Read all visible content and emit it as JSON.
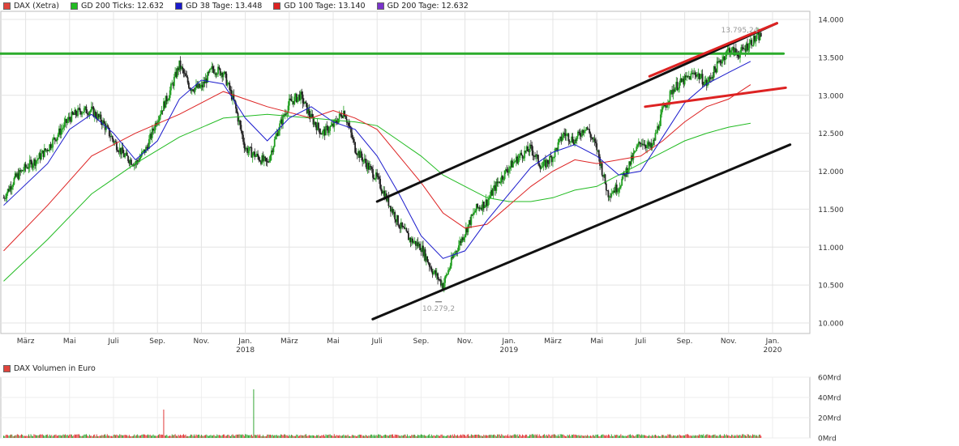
{
  "legend": [
    {
      "label": "DAX (Xetra)",
      "color": "#e0443c"
    },
    {
      "label": "GD 200 Ticks: 12.632",
      "color": "#22bb22"
    },
    {
      "label": "GD 38 Tage: 13.448",
      "color": "#1a1acc"
    },
    {
      "label": "GD 100 Tage: 13.140",
      "color": "#dd2222"
    },
    {
      "label": "GD 200 Tage: 12.632",
      "color": "#7a33cc"
    }
  ],
  "volume_label": "DAX Volumen in Euro",
  "volume_color": "#e0443c",
  "annotations": {
    "high_label": "13.795,24",
    "low_label": "10.279,2"
  },
  "chart_data": {
    "type": "line",
    "title": "DAX (Xetra)",
    "x_range": [
      "2017-02",
      "2020-02"
    ],
    "y_range": [
      10000,
      14000
    ],
    "y_ticks": [
      "14.000",
      "13.500",
      "13.000",
      "12.500",
      "12.000",
      "11.500",
      "11.000",
      "10.500",
      "10.000"
    ],
    "y_tick_values": [
      14000,
      13500,
      13000,
      12500,
      12000,
      11500,
      11000,
      10500,
      10000
    ],
    "x_ticks": [
      {
        "label": "März",
        "year": ""
      },
      {
        "label": "Mai",
        "year": ""
      },
      {
        "label": "Juli",
        "year": ""
      },
      {
        "label": "Sep.",
        "year": ""
      },
      {
        "label": "Nov.",
        "year": ""
      },
      {
        "label": "Jan.",
        "year": "2018"
      },
      {
        "label": "März",
        "year": ""
      },
      {
        "label": "Mai",
        "year": ""
      },
      {
        "label": "Juli",
        "year": ""
      },
      {
        "label": "Sep.",
        "year": ""
      },
      {
        "label": "Nov.",
        "year": ""
      },
      {
        "label": "Jan.",
        "year": "2019"
      },
      {
        "label": "März",
        "year": ""
      },
      {
        "label": "Mai",
        "year": ""
      },
      {
        "label": "Juli",
        "year": ""
      },
      {
        "label": "Sep.",
        "year": ""
      },
      {
        "label": "Nov.",
        "year": ""
      },
      {
        "label": "Jan.",
        "year": "2020"
      }
    ],
    "x_tick_months": [
      1,
      3,
      5,
      7,
      9,
      11,
      13,
      15,
      17,
      19,
      21,
      23,
      25,
      27,
      29,
      31,
      33,
      35
    ],
    "price_anchors": [
      [
        0,
        11650
      ],
      [
        0.5,
        11900
      ],
      [
        1,
        12050
      ],
      [
        1.5,
        12150
      ],
      [
        2,
        12300
      ],
      [
        2.5,
        12500
      ],
      [
        3,
        12700
      ],
      [
        3.5,
        12800
      ],
      [
        4,
        12800
      ],
      [
        4.5,
        12650
      ],
      [
        5,
        12400
      ],
      [
        5.5,
        12200
      ],
      [
        6,
        12100
      ],
      [
        6.5,
        12300
      ],
      [
        7,
        12700
      ],
      [
        7.5,
        13000
      ],
      [
        8,
        13400
      ],
      [
        8.5,
        13100
      ],
      [
        9,
        13100
      ],
      [
        9.5,
        13350
      ],
      [
        10,
        13300
      ],
      [
        10.5,
        12900
      ],
      [
        11,
        12300
      ],
      [
        11.5,
        12200
      ],
      [
        12,
        12100
      ],
      [
        12.5,
        12550
      ],
      [
        13,
        12900
      ],
      [
        13.5,
        13000
      ],
      [
        14,
        12700
      ],
      [
        14.5,
        12500
      ],
      [
        15,
        12600
      ],
      [
        15.5,
        12800
      ],
      [
        16,
        12300
      ],
      [
        16.5,
        12100
      ],
      [
        17,
        11900
      ],
      [
        17.5,
        11600
      ],
      [
        18,
        11300
      ],
      [
        18.5,
        11100
      ],
      [
        19,
        11000
      ],
      [
        19.5,
        10700
      ],
      [
        20,
        10500
      ],
      [
        20.5,
        10900
      ],
      [
        21,
        11200
      ],
      [
        21.5,
        11500
      ],
      [
        22,
        11600
      ],
      [
        22.5,
        11850
      ],
      [
        23,
        12050
      ],
      [
        23.5,
        12200
      ],
      [
        24,
        12300
      ],
      [
        24.5,
        12050
      ],
      [
        25,
        12200
      ],
      [
        25.5,
        12500
      ],
      [
        26,
        12400
      ],
      [
        26.5,
        12600
      ],
      [
        27,
        12300
      ],
      [
        27.5,
        11700
      ],
      [
        28,
        11800
      ],
      [
        28.5,
        12100
      ],
      [
        29,
        12400
      ],
      [
        29.5,
        12300
      ],
      [
        30,
        12800
      ],
      [
        30.5,
        13100
      ],
      [
        31,
        13200
      ],
      [
        31.5,
        13300
      ],
      [
        32,
        13150
      ],
      [
        32.5,
        13400
      ],
      [
        33,
        13600
      ],
      [
        33.5,
        13550
      ],
      [
        34,
        13700
      ],
      [
        34.5,
        13795
      ]
    ],
    "gd38_anchors": [
      [
        0,
        11550
      ],
      [
        2,
        12100
      ],
      [
        3,
        12550
      ],
      [
        4,
        12750
      ],
      [
        5,
        12500
      ],
      [
        6,
        12150
      ],
      [
        7,
        12400
      ],
      [
        8,
        12950
      ],
      [
        9,
        13200
      ],
      [
        10,
        13150
      ],
      [
        11,
        12700
      ],
      [
        12,
        12400
      ],
      [
        13,
        12700
      ],
      [
        14,
        12850
      ],
      [
        15,
        12650
      ],
      [
        16,
        12550
      ],
      [
        17,
        12200
      ],
      [
        18,
        11700
      ],
      [
        19,
        11150
      ],
      [
        20,
        10850
      ],
      [
        21,
        10950
      ],
      [
        22,
        11350
      ],
      [
        23,
        11700
      ],
      [
        24,
        12050
      ],
      [
        25,
        12250
      ],
      [
        26,
        12350
      ],
      [
        27,
        12200
      ],
      [
        28,
        11950
      ],
      [
        29,
        12000
      ],
      [
        30,
        12450
      ],
      [
        31,
        12900
      ],
      [
        32,
        13150
      ],
      [
        33,
        13300
      ],
      [
        34,
        13448
      ]
    ],
    "gd100_anchors": [
      [
        0,
        10950
      ],
      [
        2,
        11550
      ],
      [
        4,
        12200
      ],
      [
        6,
        12500
      ],
      [
        8,
        12750
      ],
      [
        10,
        13050
      ],
      [
        12,
        12850
      ],
      [
        14,
        12700
      ],
      [
        15,
        12800
      ],
      [
        16,
        12700
      ],
      [
        17,
        12550
      ],
      [
        18,
        12200
      ],
      [
        19,
        11850
      ],
      [
        20,
        11450
      ],
      [
        21,
        11250
      ],
      [
        22,
        11300
      ],
      [
        23,
        11550
      ],
      [
        24,
        11800
      ],
      [
        25,
        12000
      ],
      [
        26,
        12150
      ],
      [
        27,
        12100
      ],
      [
        28,
        12150
      ],
      [
        29,
        12200
      ],
      [
        30,
        12400
      ],
      [
        31,
        12650
      ],
      [
        32,
        12850
      ],
      [
        33,
        12950
      ],
      [
        34,
        13140
      ]
    ],
    "gd200_anchors": [
      [
        0,
        10550
      ],
      [
        2,
        11100
      ],
      [
        4,
        11700
      ],
      [
        6,
        12100
      ],
      [
        8,
        12450
      ],
      [
        10,
        12700
      ],
      [
        12,
        12750
      ],
      [
        14,
        12700
      ],
      [
        16,
        12650
      ],
      [
        17,
        12600
      ],
      [
        18,
        12400
      ],
      [
        19,
        12200
      ],
      [
        20,
        11950
      ],
      [
        21,
        11800
      ],
      [
        22,
        11650
      ],
      [
        23,
        11600
      ],
      [
        24,
        11600
      ],
      [
        25,
        11650
      ],
      [
        26,
        11750
      ],
      [
        27,
        11800
      ],
      [
        28,
        11950
      ],
      [
        29,
        12100
      ],
      [
        30,
        12250
      ],
      [
        31,
        12400
      ],
      [
        32,
        12500
      ],
      [
        33,
        12580
      ],
      [
        34,
        12632
      ]
    ],
    "trend_lines": [
      {
        "color": "#2cac2c",
        "from": [
          -0.3,
          13550
        ],
        "to": [
          35.5,
          13550
        ]
      },
      {
        "color": "#111111",
        "from": [
          17.0,
          11600
        ],
        "to": [
          35.2,
          13950
        ]
      },
      {
        "color": "#111111",
        "from": [
          16.8,
          10050
        ],
        "to": [
          35.8,
          12350
        ]
      },
      {
        "color": "#dd2222",
        "from": [
          29.4,
          13250
        ],
        "to": [
          35.2,
          13950
        ]
      },
      {
        "color": "#dd2222",
        "from": [
          29.2,
          12850
        ],
        "to": [
          35.6,
          13100
        ]
      }
    ],
    "high_point": [
      34.5,
      13795
    ],
    "low_point": [
      19.8,
      10279
    ],
    "volume_ticks": [
      "60Mrd",
      "40Mrd",
      "20Mrd",
      "0Mrd"
    ],
    "volume_tick_values": [
      60,
      40,
      20,
      0
    ],
    "volume_range": [
      0,
      60
    ],
    "volume_base": 2.5,
    "volume_spikes": [
      [
        7.3,
        28
      ],
      [
        11.4,
        48
      ]
    ]
  }
}
